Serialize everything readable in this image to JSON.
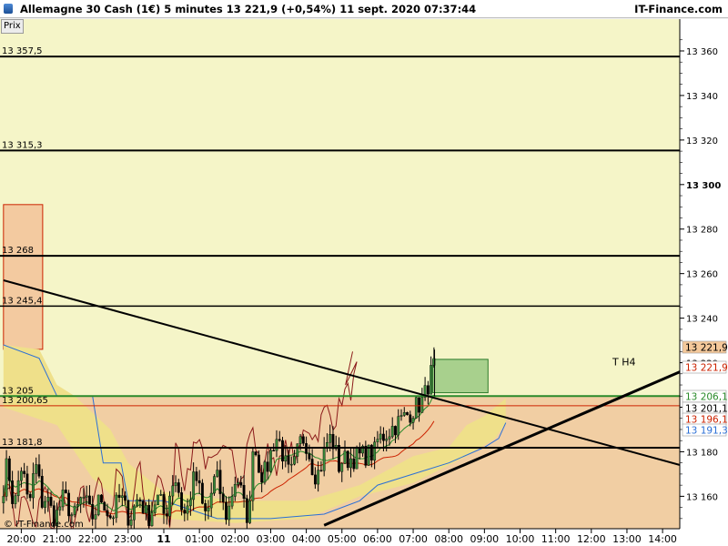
{
  "header": {
    "title": "Allemagne 30 Cash (1€)   5 minutes   13 221,9 (+0,54%)   11 sept. 2020 07:37:44",
    "brand": "IT-Finance.com",
    "price_label": "Prix",
    "watermark": "© IT-Finance.com"
  },
  "colors": {
    "zone_top": "#f5f5c8",
    "zone_bottom": "#f1cea3",
    "cloud": "#efe08a",
    "resistance_box": "#f3caa0",
    "support_box": "#a8d08d",
    "candle_up": "#3a8a3a",
    "candle_down": "#000000",
    "red_line": "#cc2200",
    "green_line": "#2a8a2a",
    "blue_line": "#2b6fd6",
    "brown_line": "#8b1a1a"
  },
  "chart_data": {
    "type": "candlestick",
    "title": "Allemagne 30 Cash (1€)",
    "timeframe": "5 minutes",
    "last_price": 13221.9,
    "ylim": [
      13147,
      13368
    ],
    "y_ticks": [
      13160,
      13180,
      13200,
      13220,
      13240,
      13260,
      13280,
      13300,
      13320,
      13340,
      13360
    ],
    "y_tick_labels": [
      "13 160",
      "13 180",
      "13 200",
      "13 220",
      "13 240",
      "13 260",
      "13 280",
      "13 300",
      "13 320",
      "13 340",
      "13 360"
    ],
    "x_ticks": [
      {
        "label": "20:00",
        "h": -4
      },
      {
        "label": "21:00",
        "h": -3
      },
      {
        "label": "22:00",
        "h": -2
      },
      {
        "label": "23:00",
        "h": -1
      },
      {
        "label": "11",
        "h": 0,
        "bold": true
      },
      {
        "label": "01:00",
        "h": 1
      },
      {
        "label": "02:00",
        "h": 2
      },
      {
        "label": "03:00",
        "h": 3
      },
      {
        "label": "04:00",
        "h": 4
      },
      {
        "label": "05:00",
        "h": 5
      },
      {
        "label": "06:00",
        "h": 6
      },
      {
        "label": "07:00",
        "h": 7
      },
      {
        "label": "08:00",
        "h": 8
      },
      {
        "label": "09:00",
        "h": 9
      },
      {
        "label": "10:00",
        "h": 10
      },
      {
        "label": "11:00",
        "h": 11
      },
      {
        "label": "12:00",
        "h": 12
      },
      {
        "label": "13:00",
        "h": 13
      },
      {
        "label": "14:00",
        "h": 14
      }
    ],
    "levels": [
      {
        "label": "13 357,5",
        "value": 13357.5,
        "color": "#000000",
        "width": 2
      },
      {
        "label": "13 315,3",
        "value": 13315.3,
        "color": "#000000",
        "width": 2
      },
      {
        "label": "13 268",
        "value": 13268,
        "color": "#000000",
        "width": 2
      },
      {
        "label": "13 245,4",
        "value": 13245.4,
        "color": "#000000",
        "width": 1.5
      },
      {
        "label": "13 205",
        "value": 13205,
        "color": "#2a8a2a",
        "width": 2
      },
      {
        "label": "13 200,65",
        "value": 13200.65,
        "color": "#cc2200",
        "width": 1
      },
      {
        "label": "13 181,8",
        "value": 13181.8,
        "color": "#000000",
        "width": 2
      }
    ],
    "price_tags": [
      {
        "label": "13 221,9",
        "value": 13221.9,
        "bg": "#f4c89a",
        "fg": "#000000"
      },
      {
        "label": "13 221,9",
        "value": 13221.9,
        "bg": "#ffffff",
        "fg": "#cc2200"
      },
      {
        "label": "13 206,1",
        "value": 13206.1,
        "bg": "#ffffff",
        "fg": "#2a8a2a"
      },
      {
        "label": "13 201,1",
        "value": 13201.1,
        "bg": "#ffffff",
        "fg": "#000000"
      },
      {
        "label": "13 196,1",
        "value": 13196.1,
        "bg": "#ffffff",
        "fg": "#cc2200"
      },
      {
        "label": "13 191,3",
        "value": 13191.3,
        "bg": "#ffffff",
        "fg": "#2b6fd6"
      }
    ],
    "annotation": {
      "label": "T H4",
      "h": 12.9,
      "value": 13220.5
    },
    "trendlines": [
      {
        "from": {
          "h": -4.5,
          "v": 13257
        },
        "to": {
          "h": 14.5,
          "v": 13174
        },
        "width": 2
      },
      {
        "from": {
          "h": 4.5,
          "v": 13147
        },
        "to": {
          "h": 14.5,
          "v": 13216
        },
        "width": 3
      }
    ],
    "zones": [
      {
        "name": "resistance_box",
        "x0": -4.5,
        "x1": -3.4,
        "v0": 13291,
        "v1": 13226
      },
      {
        "name": "support_box",
        "x0": 7.55,
        "x1": 9.1,
        "v0": 13221.5,
        "v1": 13206.5
      }
    ]
  }
}
